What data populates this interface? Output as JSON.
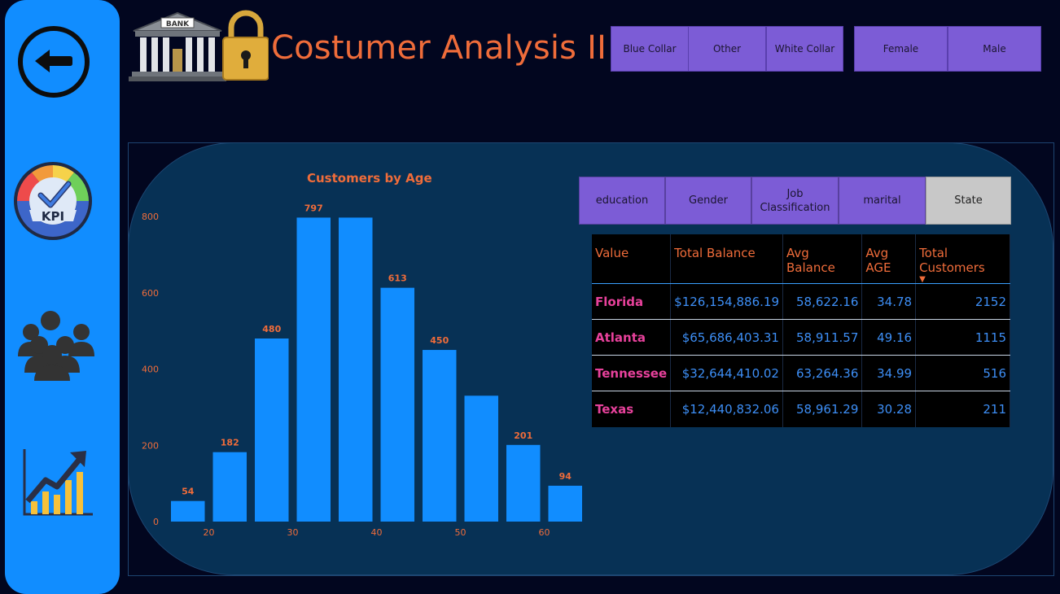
{
  "header": {
    "title": "Costumer Analysis II",
    "logo_text": "BANK"
  },
  "slicers": {
    "job": [
      "Blue Collar",
      "Other",
      "White Collar"
    ],
    "gender": [
      "Female",
      "Male"
    ]
  },
  "tabs": [
    {
      "label": "education",
      "active": false
    },
    {
      "label": "Gender",
      "active": false
    },
    {
      "label": "Job Classification",
      "active": false
    },
    {
      "label": "marital",
      "active": false
    },
    {
      "label": "State",
      "active": true
    }
  ],
  "chart_data": {
    "type": "bar",
    "title": "Customers by Age",
    "xlabel": "",
    "ylabel": "",
    "bins_center": [
      17.5,
      22.5,
      27.5,
      32.5,
      37.5,
      42.5,
      47.5,
      52.5,
      57.5,
      62.5
    ],
    "values": [
      54,
      182,
      480,
      797,
      797,
      613,
      450,
      330,
      201,
      94
    ],
    "data_labels": [
      "54",
      "182",
      "480",
      "797",
      "",
      "613",
      "450",
      "",
      "201",
      "94"
    ],
    "ylim": [
      0,
      800
    ],
    "yticks": [
      0,
      200,
      400,
      600,
      800
    ],
    "xticks": [
      20,
      30,
      40,
      50,
      60
    ],
    "bar_color": "#118dff",
    "label_color": "#ef6c3a",
    "grid": false
  },
  "table": {
    "columns": [
      "Value",
      "Total Balance",
      "Avg Balance",
      "Avg AGE",
      "Total Customers"
    ],
    "rows": [
      [
        "Florida",
        "$126,154,886.19",
        "58,622.16",
        "34.78",
        "2152"
      ],
      [
        "Atlanta",
        "$65,686,403.31",
        "58,911.57",
        "49.16",
        "1115"
      ],
      [
        "Tennessee",
        "$32,644,410.02",
        "63,264.36",
        "34.99",
        "516"
      ],
      [
        "Texas",
        "$12,440,832.06",
        "58,961.29",
        "30.28",
        "211"
      ]
    ]
  },
  "colors": {
    "accent": "#ef6c3a",
    "sidebar": "#118dff",
    "slicer": "#7c5cd6",
    "background": "#02061f",
    "panel": "#073155",
    "state_name": "#e7419b",
    "value_text": "#3d8ef5"
  },
  "icons": {
    "back": "back-arrow-icon",
    "kpi": "kpi-gauge-icon",
    "customers": "people-group-icon",
    "growth": "growth-chart-icon",
    "logo": "bank-padlock-icon"
  }
}
